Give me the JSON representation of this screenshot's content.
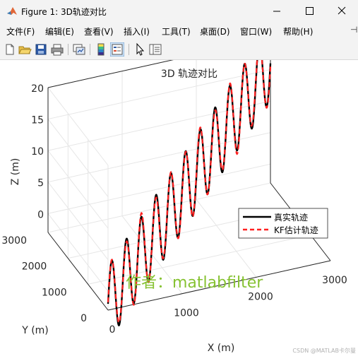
{
  "window": {
    "title": "Figure 1: 3D轨迹对比",
    "minimize_icon": "minimize-icon",
    "maximize_icon": "maximize-icon",
    "close_icon": "close-icon",
    "app_icon": "matlab-logo-icon"
  },
  "menu": {
    "items": [
      "文件(F)",
      "编辑(E)",
      "查看(V)",
      "插入(I)",
      "工具(T)",
      "桌面(D)",
      "窗口(W)",
      "帮助(H)"
    ],
    "overflow_icon": "pin-icon"
  },
  "toolbar": {
    "icons": [
      "new-figure-icon",
      "open-file-icon",
      "save-icon",
      "print-icon",
      "link-plot-icon",
      "insert-colorbar-icon",
      "insert-legend-icon",
      "select-pointer-icon",
      "property-inspector-icon"
    ]
  },
  "colors": {
    "true_line": "#000000",
    "kf_line": "#ff2020",
    "watermark": "#86c232",
    "axis": "#262626",
    "grid": "#e6e6e6"
  },
  "chart_data": {
    "type": "line",
    "dims": 3,
    "title": "3D 轨迹对比",
    "xlabel": "X (m)",
    "ylabel": "Y (m)",
    "zlabel": "Z (m)",
    "xlim": [
      0,
      3000
    ],
    "ylim": [
      0,
      3000
    ],
    "zlim": [
      -3,
      20
    ],
    "xticks": [
      "0",
      "1000",
      "2000",
      "3000"
    ],
    "yticks": [
      "0",
      "1000",
      "2000",
      "3000"
    ],
    "zticks": [
      "0",
      "5",
      "10",
      "15",
      "20"
    ],
    "grid": true,
    "legend_location": "east",
    "series": [
      {
        "name": "真实轨迹",
        "style": "solid",
        "color": "#000000"
      },
      {
        "name": "KF估计轨迹",
        "style": "dashed",
        "color": "#ff2020"
      }
    ],
    "trajectory": {
      "x_range": [
        0,
        3000
      ],
      "y_range": [
        0,
        3000
      ],
      "z_baseline_range": [
        -2,
        16
      ],
      "z_amplitude": 6,
      "oscillations": 11
    }
  },
  "watermark": "作者：matlabfilter",
  "credit": "CSDN @MATLAB卡尔曼"
}
